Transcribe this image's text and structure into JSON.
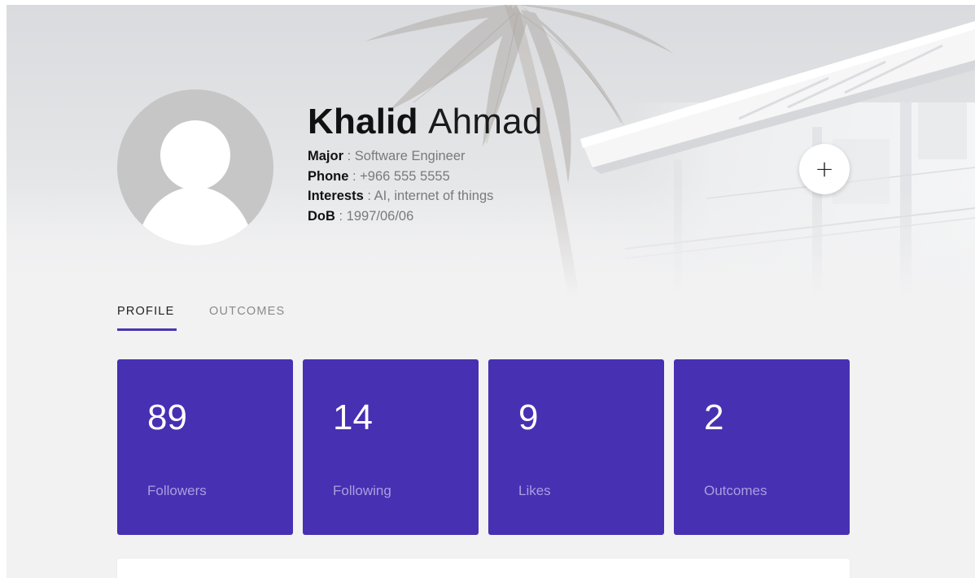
{
  "profile": {
    "first_name": "Khalid",
    "last_name": "Ahmad",
    "details": [
      {
        "label": "Major",
        "value": " : Software Engineer"
      },
      {
        "label": "Phone",
        "value": " : +966 555 5555"
      },
      {
        "label": "Interests",
        "value": " : AI, internet of things"
      },
      {
        "label": "DoB",
        "value": " : 1997/06/06"
      }
    ]
  },
  "actions": {
    "add_label": "+",
    "add_icon": "plus-icon"
  },
  "tabs": [
    {
      "label": "PROFILE",
      "active": true
    },
    {
      "label": "OUTCOMES",
      "active": false
    }
  ],
  "stats": [
    {
      "value": "89",
      "label": "Followers"
    },
    {
      "value": "14",
      "label": "Following"
    },
    {
      "value": "9",
      "label": "Likes"
    },
    {
      "value": "2",
      "label": "Outcomes"
    }
  ],
  "colors": {
    "accent": "#4730b2",
    "tab_indicator": "#4b35b1",
    "stat_label": "#a99fe0",
    "page_background": "#f2f2f3"
  },
  "icons": {
    "avatar": "user-silhouette-icon",
    "hero": "palm-tree-building-background"
  }
}
